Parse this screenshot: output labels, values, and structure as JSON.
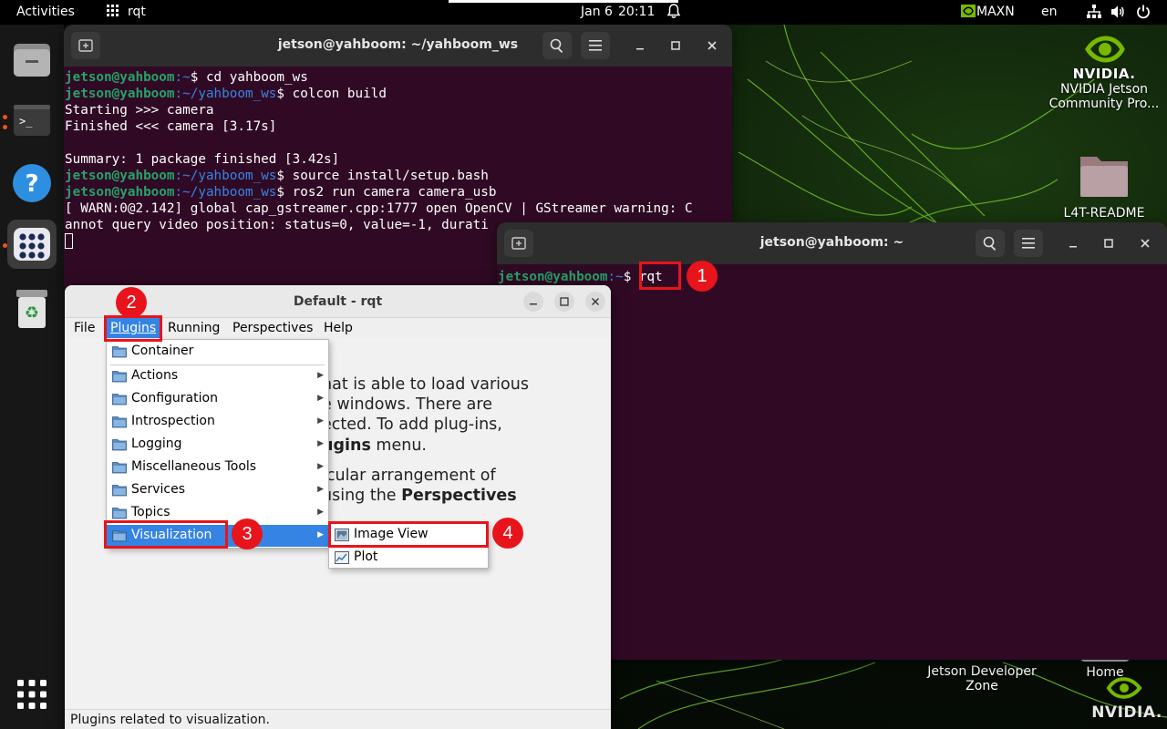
{
  "topbar": {
    "activities": "Activities",
    "app_name": "rqt",
    "date": "Jan 6",
    "time": "20:11",
    "power_mode": "MAXN",
    "language": "en"
  },
  "desktop": {
    "nvidia_logo_text": "NVIDIA.",
    "icons": [
      {
        "label_line1": "NVIDIA Jetson",
        "label_line2": "Community Pro..."
      },
      {
        "label_line1": "L4T-README",
        "label_line2": ""
      },
      {
        "label_line1": "Jetson Developer",
        "label_line2": "Zone"
      },
      {
        "label_line1": "Home",
        "label_line2": ""
      }
    ],
    "corner_logo_text": "NVIDIA."
  },
  "terminal1": {
    "title": "jetson@yahboom: ~/yahboom_ws",
    "lines": [
      {
        "user": "jetson@yahboom",
        "path": ":~",
        "cmd": "$ cd yahboom_ws",
        "text": ""
      },
      {
        "user": "jetson@yahboom",
        "path": ":~/yahboom_ws",
        "cmd": "$ colcon build",
        "text": ""
      },
      {
        "user": "",
        "path": "",
        "cmd": "",
        "text": "Starting >>> camera"
      },
      {
        "user": "",
        "path": "",
        "cmd": "",
        "text": "Finished <<< camera [3.17s]"
      },
      {
        "user": "",
        "path": "",
        "cmd": "",
        "text": ""
      },
      {
        "user": "",
        "path": "",
        "cmd": "",
        "text": "Summary: 1 package finished [3.42s]"
      },
      {
        "user": "jetson@yahboom",
        "path": ":~/yahboom_ws",
        "cmd": "$ source install/setup.bash",
        "text": ""
      },
      {
        "user": "jetson@yahboom",
        "path": ":~/yahboom_ws",
        "cmd": "$ ros2 run camera camera_usb",
        "text": ""
      },
      {
        "user": "",
        "path": "",
        "cmd": "",
        "text": "[ WARN:0@2.142] global cap_gstreamer.cpp:1777 open OpenCV | GStreamer warning: C"
      },
      {
        "user": "",
        "path": "",
        "cmd": "",
        "text": "annot query video position: status=0, value=-1, durati"
      }
    ]
  },
  "terminal2": {
    "title": "jetson@yahboom: ~",
    "prompt_user": "jetson@yahboom",
    "prompt_path": ":~",
    "prompt_dollar": "$ ",
    "command": "rqt"
  },
  "rqt": {
    "title": "Default - rqt",
    "menus": {
      "file": "File",
      "plugins": "Plugins",
      "running": "Running",
      "perspectives": "Perspectives",
      "help": "Help"
    },
    "content": {
      "line1": "hat is able to load various",
      "line2": "e windows. There are",
      "line3": "ected. To add plug-ins,",
      "line4_bold": "ugins",
      "line4_rest": " menu.",
      "line5": "icular arrangement of",
      "line6_pre": "using the ",
      "line6_bold": "Perspectives"
    },
    "status": "Plugins related to visualization."
  },
  "plugins_menu": {
    "items": [
      "Container",
      "Actions",
      "Configuration",
      "Introspection",
      "Logging",
      "Miscellaneous Tools",
      "Services",
      "Topics",
      "Visualization"
    ]
  },
  "visualization_submenu": {
    "items": [
      "Image View",
      "Plot"
    ]
  },
  "annotations": [
    "1",
    "2",
    "3",
    "4"
  ]
}
